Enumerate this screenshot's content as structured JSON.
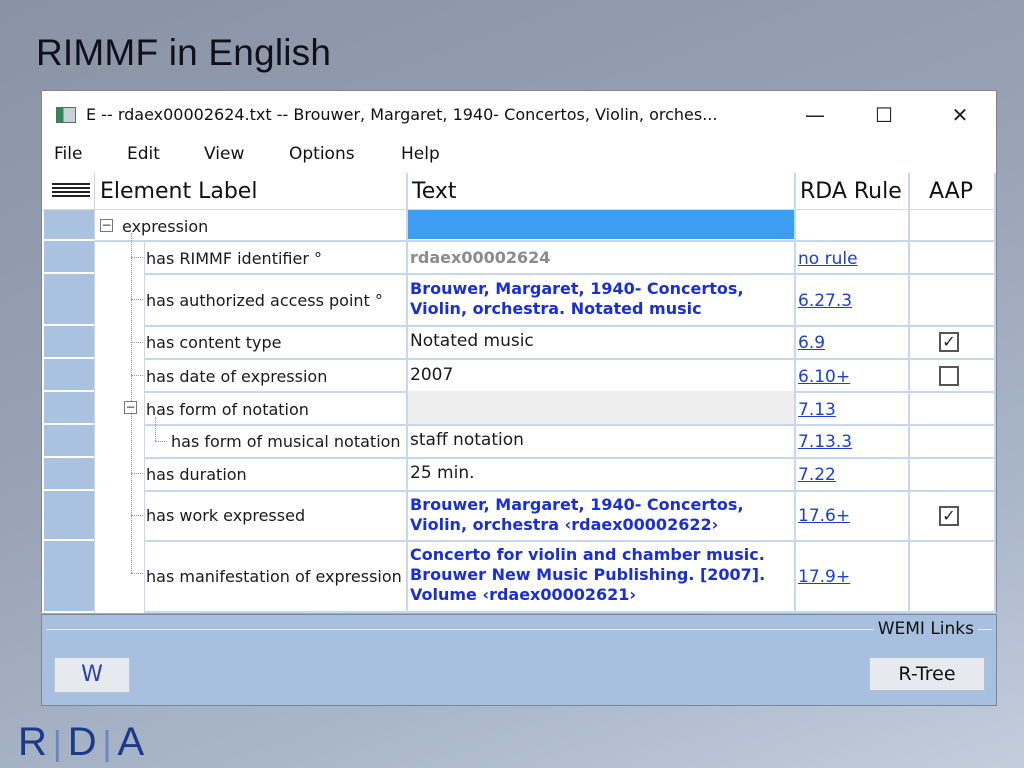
{
  "slide": {
    "title": "RIMMF in English",
    "logo": "R|D|A"
  },
  "window": {
    "title": "E  --  rdaex00002624.txt  --  Brouwer, Margaret, 1940- Concertos, Violin, orches...",
    "controls": {
      "minimize": "—",
      "maximize": "☐",
      "close": "✕"
    }
  },
  "menu": [
    "File",
    "Edit",
    "View",
    "Options",
    "Help"
  ],
  "grid": {
    "columns": {
      "label": "Element Label",
      "text": "Text",
      "rule": "RDA Rule",
      "aap": "AAP"
    },
    "rows": [
      {
        "label": "expression",
        "text": "",
        "rule": "",
        "aap": "none"
      },
      {
        "label": "has RIMMF identifier °",
        "text": "rdaex00002624",
        "rule": "no rule",
        "aap": "none"
      },
      {
        "label": "has authorized access point °",
        "text": "Brouwer, Margaret, 1940- Concertos, Violin, orchestra. Notated music",
        "rule": "6.27.3",
        "aap": "none"
      },
      {
        "label": "has content type",
        "text": "Notated music",
        "rule": "6.9",
        "aap": "checked"
      },
      {
        "label": "has date of expression",
        "text": "2007",
        "rule": "6.10+",
        "aap": "unchecked"
      },
      {
        "label": "has form of notation",
        "text": "",
        "rule": "7.13",
        "aap": "none"
      },
      {
        "label": "has form of musical notation",
        "text": "staff notation",
        "rule": "7.13.3",
        "aap": "none"
      },
      {
        "label": "has duration",
        "text": "25 min.",
        "rule": "7.22",
        "aap": "none"
      },
      {
        "label": "has work expressed",
        "text": "Brouwer, Margaret, 1940- Concertos, Violin, orchestra ‹rdaex00002622›",
        "rule": "17.6+",
        "aap": "checked"
      },
      {
        "label": "has manifestation of expression",
        "text": "Concerto for violin and chamber music. Brouwer New Music Publishing. [2007]. Volume ‹rdaex00002621›",
        "rule": "17.9+",
        "aap": "none"
      }
    ]
  },
  "bottom": {
    "group_label": "WEMI Links",
    "w_button": "W",
    "rtree_button": "R-Tree"
  },
  "colors": {
    "accent_link": "#1a3fd1",
    "selection": "#3d9df3",
    "row_header": "#a9c2e0",
    "panel": "#a8c0df"
  }
}
